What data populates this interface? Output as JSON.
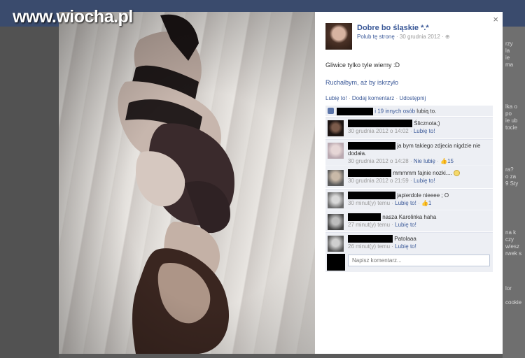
{
  "watermark": "www.wiocha.pl",
  "background_right_snippets": [
    "rzy",
    "la",
    "ie",
    "ma",
    "lka o",
    "po",
    "ie ub",
    "tocie",
    "ra?",
    "o za",
    "9 Sty",
    "na k",
    "czy",
    "wiesz",
    "rwek s",
    "lor",
    "cookie"
  ],
  "panel": {
    "close_label": "×",
    "page_name": "Dobre bo śląskie *.*",
    "like_page_label": "Polub tę stronę",
    "post_date": "· 30 grudnia 2012 ·",
    "post_text": "Gliwice tylko tyle wiemy :D",
    "post_link": "Ruchałbym, aż by iskrzyło",
    "actions": {
      "like": "Lubię to!",
      "comment": "Dodaj komentarz",
      "share": "Udostępnij"
    },
    "likes": {
      "others": "i 19 innych osób",
      "suffix": "lubią to."
    },
    "comments": [
      {
        "text": "Ślicznota;)",
        "time": "30 grudnia 2012 o 14:02",
        "action": "Lubię to!",
        "likes": ""
      },
      {
        "text": "ja bym takiego zdjecia nigdzie nie dodała.",
        "time": "30 grudnia 2012 o 14:28",
        "action": "Nie lubię",
        "likes": "15"
      },
      {
        "text": "mmmmm fajnie nozki....",
        "time": "30 grudnia 2012 o 21:59",
        "action": "Lubię to!",
        "likes": ""
      },
      {
        "text": "japierdole nieeee ; O",
        "time": "30 minut(y) temu",
        "action": "Lubię to!",
        "likes": "1"
      },
      {
        "text": "nasza Karolinka haha",
        "time": "27 minut(y) temu",
        "action": "Lubię to!",
        "likes": ""
      },
      {
        "text": "Patolaaa",
        "time": "26 minut(y) temu",
        "action": "Lubię to!",
        "likes": ""
      }
    ],
    "comment_placeholder": "Napisz komentarz..."
  }
}
